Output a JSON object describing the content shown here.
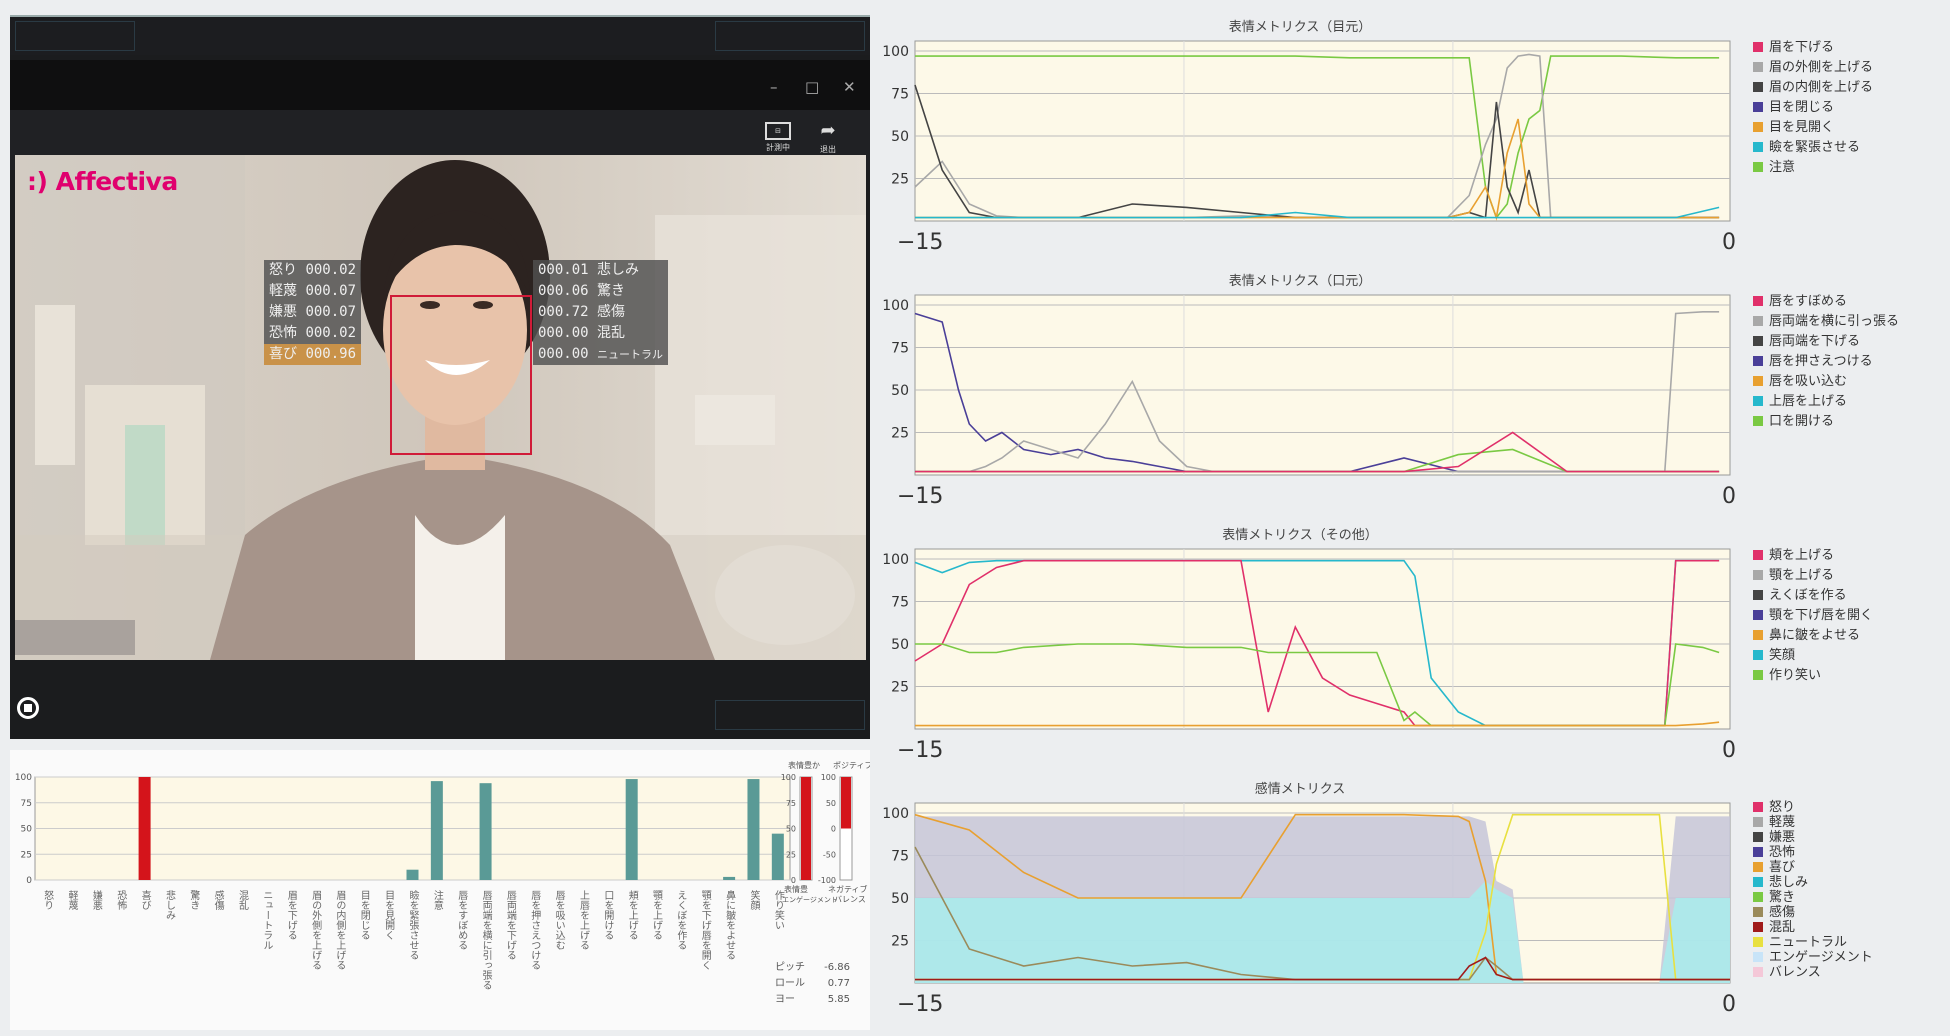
{
  "camera_app": {
    "logo": ":) Affectiva",
    "window_controls": {
      "minimize": "–",
      "maximize": "□",
      "close": "✕"
    },
    "toolbar": [
      {
        "label": "計測中",
        "icon": "record-icon"
      },
      {
        "label": "退出",
        "icon": "exit-icon"
      }
    ],
    "emotions_left": [
      {
        "label": "怒り",
        "value": "000.02"
      },
      {
        "label": "軽蔑",
        "value": "000.07"
      },
      {
        "label": "嫌悪",
        "value": "000.07"
      },
      {
        "label": "恐怖",
        "value": "000.02"
      },
      {
        "label": "喜び",
        "value": "000.96",
        "highlight": true
      }
    ],
    "emotions_right": [
      {
        "label": "悲しみ",
        "value": "000.01"
      },
      {
        "label": "驚き",
        "value": "000.06"
      },
      {
        "label": "感傷",
        "value": "000.72"
      },
      {
        "label": "混乱",
        "value": "000.00"
      },
      {
        "label": "ニュートラル",
        "value": "000.00"
      }
    ],
    "accent": "#e0006e",
    "face_box_color": "#d01b38"
  },
  "bar_panel": {
    "y_ticks": [
      "100",
      "75",
      "50",
      "25",
      "0"
    ],
    "bars": [
      {
        "label": "怒り",
        "value": 0,
        "color": "#5a9a96"
      },
      {
        "label": "軽蔑",
        "value": 0,
        "color": "#5a9a96"
      },
      {
        "label": "嫌悪",
        "value": 0,
        "color": "#5a9a96"
      },
      {
        "label": "恐怖",
        "value": 0,
        "color": "#5a9a96"
      },
      {
        "label": "喜び",
        "value": 100,
        "color": "#d4141b"
      },
      {
        "label": "悲しみ",
        "value": 0,
        "color": "#5a9a96"
      },
      {
        "label": "驚き",
        "value": 0,
        "color": "#5a9a96"
      },
      {
        "label": "感傷",
        "value": 0,
        "color": "#5a9a96"
      },
      {
        "label": "混乱",
        "value": 0,
        "color": "#5a9a96"
      },
      {
        "label": "ニュートラル",
        "value": 0,
        "color": "#5a9a96"
      },
      {
        "label": "眉を下げる",
        "value": 0,
        "color": "#5a9a96"
      },
      {
        "label": "眉の外側を上げる",
        "value": 0,
        "color": "#5a9a96"
      },
      {
        "label": "眉の内側を上げる",
        "value": 0,
        "color": "#5a9a96"
      },
      {
        "label": "目を閉じる",
        "value": 0,
        "color": "#5a9a96"
      },
      {
        "label": "目を見開く",
        "value": 0,
        "color": "#5a9a96"
      },
      {
        "label": "瞼を緊張させる",
        "value": 10,
        "color": "#5a9a96"
      },
      {
        "label": "注意",
        "value": 96,
        "color": "#5a9a96"
      },
      {
        "label": "唇をすぼめる",
        "value": 0,
        "color": "#5a9a96"
      },
      {
        "label": "唇両端を横に引っ張る",
        "value": 94,
        "color": "#5a9a96"
      },
      {
        "label": "唇両端を下げる",
        "value": 0,
        "color": "#5a9a96"
      },
      {
        "label": "唇を押さえつける",
        "value": 0,
        "color": "#5a9a96"
      },
      {
        "label": "唇を吸い込む",
        "value": 0,
        "color": "#5a9a96"
      },
      {
        "label": "上唇を上げる",
        "value": 0,
        "color": "#5a9a96"
      },
      {
        "label": "口を開ける",
        "value": 0,
        "color": "#5a9a96"
      },
      {
        "label": "頬を上げる",
        "value": 98,
        "color": "#5a9a96"
      },
      {
        "label": "顎を上げる",
        "value": 0,
        "color": "#5a9a96"
      },
      {
        "label": "えくぼを作る",
        "value": 0,
        "color": "#5a9a96"
      },
      {
        "label": "顎を下げ唇を開く",
        "value": 0,
        "color": "#5a9a96"
      },
      {
        "label": "鼻に皺をよせる",
        "value": 3,
        "color": "#5a9a96"
      },
      {
        "label": "笑顔",
        "value": 98,
        "color": "#5a9a96"
      },
      {
        "label": "作り笑い",
        "value": 45,
        "color": "#5a9a96"
      }
    ],
    "engagement": {
      "title": "表情豊か",
      "label": "エンゲージメント",
      "label_top": "表情豊",
      "ticks": [
        "100",
        "75",
        "50",
        "25",
        "0"
      ],
      "value": 100
    },
    "valence": {
      "title": "ポジティブ",
      "label": "ネガティブ",
      "label2": "バレンス",
      "ticks": [
        "100",
        "50",
        "0",
        "-50",
        "-100"
      ],
      "value": 100
    },
    "head_pose": [
      {
        "label": "ピッチ",
        "value": "-6.86"
      },
      {
        "label": "ロール",
        "value": "0.77"
      },
      {
        "label": "ヨー",
        "value": "5.85"
      }
    ]
  },
  "line_panels": [
    {
      "title": "表情メトリクス（目元）",
      "legend": [
        {
          "name": "眉を下げる",
          "color": "#e0306a"
        },
        {
          "name": "眉の外側を上げる",
          "color": "#a8a8a8"
        },
        {
          "name": "眉の内側を上げる",
          "color": "#444444"
        },
        {
          "name": "目を閉じる",
          "color": "#4a3f98"
        },
        {
          "name": "目を見開く",
          "color": "#e8a030"
        },
        {
          "name": "瞼を緊張させる",
          "color": "#26b8cc"
        },
        {
          "name": "注意",
          "color": "#7ac943"
        }
      ]
    },
    {
      "title": "表情メトリクス（口元）",
      "legend": [
        {
          "name": "唇をすぼめる",
          "color": "#e0306a"
        },
        {
          "name": "唇両端を横に引っ張る",
          "color": "#a8a8a8"
        },
        {
          "name": "唇両端を下げる",
          "color": "#444444"
        },
        {
          "name": "唇を押さえつける",
          "color": "#4a3f98"
        },
        {
          "name": "唇を吸い込む",
          "color": "#e8a030"
        },
        {
          "name": "上唇を上げる",
          "color": "#26b8cc"
        },
        {
          "name": "口を開ける",
          "color": "#7ac943"
        }
      ]
    },
    {
      "title": "表情メトリクス（その他）",
      "legend": [
        {
          "name": "頬を上げる",
          "color": "#e0306a"
        },
        {
          "name": "顎を上げる",
          "color": "#a8a8a8"
        },
        {
          "name": "えくぼを作る",
          "color": "#444444"
        },
        {
          "name": "顎を下げ唇を開く",
          "color": "#4a3f98"
        },
        {
          "name": "鼻に皺をよせる",
          "color": "#e8a030"
        },
        {
          "name": "笑顔",
          "color": "#26b8cc"
        },
        {
          "name": "作り笑い",
          "color": "#7ac943"
        }
      ]
    },
    {
      "title": "感情メトリクス",
      "legend": [
        {
          "name": "怒り",
          "color": "#e0306a"
        },
        {
          "name": "軽蔑",
          "color": "#a8a8a8"
        },
        {
          "name": "嫌悪",
          "color": "#444444"
        },
        {
          "name": "恐怖",
          "color": "#4a3f98"
        },
        {
          "name": "喜び",
          "color": "#e8a030"
        },
        {
          "name": "悲しみ",
          "color": "#26b8cc"
        },
        {
          "name": "驚き",
          "color": "#7ac943"
        },
        {
          "name": "感傷",
          "color": "#9a8a5a"
        },
        {
          "name": "混乱",
          "color": "#a01a1a"
        },
        {
          "name": "ニュートラル",
          "color": "#e8e040"
        },
        {
          "name": "エンゲージメント",
          "color": "#c8e4f8"
        },
        {
          "name": "バレンス",
          "color": "#f4c8d8"
        }
      ]
    }
  ],
  "line_axes": {
    "y_ticks": [
      "100",
      "75",
      "50",
      "25"
    ],
    "x_min": "−15",
    "x_max": "0",
    "plot_bg": "#fdf9e8"
  },
  "chart_data": [
    {
      "type": "line",
      "title": "表情メトリクス（目元）",
      "xlim": [
        -15,
        0
      ],
      "ylim": [
        0,
        100
      ],
      "x": [
        -15,
        -14.5,
        -14,
        -13.5,
        -13,
        -12,
        -11,
        -10,
        -9,
        -8,
        -7,
        -6,
        -5.2,
        -4.8,
        -4.5,
        -4.3,
        -4.1,
        -3.9,
        -3.7,
        -3.5,
        -3.3,
        -3.1,
        -2.9,
        -2,
        -1,
        -0.2
      ],
      "series": [
        {
          "name": "注意",
          "values": [
            97,
            97,
            97,
            97,
            97,
            97,
            97,
            97,
            97,
            97,
            96,
            96,
            96,
            96,
            20,
            2,
            10,
            40,
            60,
            65,
            97,
            97,
            97,
            97,
            96,
            96
          ]
        },
        {
          "name": "眉の外側を上げる",
          "values": [
            20,
            35,
            10,
            3,
            2,
            2,
            2,
            2,
            3,
            2,
            2,
            2,
            2,
            15,
            45,
            60,
            90,
            97,
            98,
            97,
            2,
            2,
            2,
            2,
            2,
            2
          ]
        },
        {
          "name": "眉の内側を上げる",
          "values": [
            80,
            30,
            5,
            2,
            2,
            2,
            10,
            8,
            5,
            2,
            2,
            2,
            2,
            5,
            2,
            70,
            20,
            5,
            30,
            2,
            2,
            2,
            2,
            2,
            2,
            2
          ]
        },
        {
          "name": "目を見開く",
          "values": [
            2,
            2,
            2,
            2,
            2,
            2,
            2,
            2,
            2,
            2,
            2,
            2,
            2,
            5,
            20,
            2,
            40,
            60,
            10,
            2,
            2,
            2,
            2,
            2,
            2,
            2
          ]
        },
        {
          "name": "瞼を緊張させる",
          "values": [
            2,
            2,
            2,
            2,
            2,
            2,
            2,
            2,
            2,
            5,
            2,
            2,
            2,
            2,
            2,
            2,
            2,
            2,
            2,
            2,
            2,
            2,
            2,
            2,
            2,
            8
          ]
        }
      ]
    },
    {
      "type": "line",
      "title": "表情メトリクス（口元）",
      "xlim": [
        -15,
        0
      ],
      "ylim": [
        0,
        100
      ],
      "x": [
        -15,
        -14.5,
        -14.2,
        -14,
        -13.7,
        -13.4,
        -13,
        -12.5,
        -12,
        -11.5,
        -11,
        -10.5,
        -10,
        -9.5,
        -9,
        -8,
        -7,
        -6,
        -5,
        -4,
        -3,
        -2,
        -1.2,
        -1,
        -0.5,
        -0.2
      ],
      "series": [
        {
          "name": "唇を押さえつける",
          "values": [
            95,
            90,
            50,
            30,
            20,
            25,
            15,
            12,
            15,
            10,
            8,
            5,
            2,
            2,
            2,
            2,
            2,
            10,
            2,
            2,
            2,
            2,
            2,
            2,
            2,
            2
          ]
        },
        {
          "name": "唇両端を横に引っ張る",
          "values": [
            2,
            2,
            2,
            2,
            5,
            10,
            20,
            15,
            10,
            30,
            55,
            20,
            5,
            2,
            2,
            2,
            2,
            2,
            2,
            2,
            2,
            2,
            2,
            95,
            96,
            96
          ]
        },
        {
          "name": "口を開ける",
          "values": [
            2,
            2,
            2,
            2,
            2,
            2,
            2,
            2,
            2,
            2,
            2,
            2,
            2,
            2,
            2,
            2,
            2,
            2,
            12,
            15,
            2,
            2,
            2,
            2,
            2,
            2
          ]
        },
        {
          "name": "唇をすぼめる",
          "values": [
            2,
            2,
            2,
            2,
            2,
            2,
            2,
            2,
            2,
            2,
            2,
            2,
            2,
            2,
            2,
            2,
            2,
            2,
            5,
            25,
            2,
            2,
            2,
            2,
            2,
            2
          ]
        }
      ]
    },
    {
      "type": "line",
      "title": "表情メトリクス（その他）",
      "xlim": [
        -15,
        0
      ],
      "ylim": [
        0,
        100
      ],
      "x": [
        -15,
        -14.5,
        -14,
        -13.5,
        -13,
        -12,
        -11,
        -10,
        -9,
        -8.5,
        -8,
        -7.5,
        -7,
        -6.5,
        -6,
        -5.8,
        -5.5,
        -5,
        -4.5,
        -4,
        -3,
        -2,
        -1.2,
        -1,
        -0.5,
        -0.2
      ],
      "series": [
        {
          "name": "笑顔",
          "values": [
            98,
            92,
            98,
            99,
            99,
            99,
            99,
            99,
            99,
            99,
            99,
            99,
            99,
            99,
            99,
            90,
            30,
            10,
            2,
            2,
            2,
            2,
            2,
            99,
            99,
            99
          ]
        },
        {
          "name": "頬を上げる",
          "values": [
            40,
            50,
            85,
            95,
            99,
            99,
            99,
            99,
            99,
            10,
            60,
            30,
            20,
            15,
            10,
            2,
            2,
            2,
            2,
            2,
            2,
            2,
            2,
            99,
            99,
            99
          ]
        },
        {
          "name": "作り笑い",
          "values": [
            50,
            50,
            45,
            45,
            48,
            50,
            50,
            48,
            48,
            45,
            45,
            45,
            45,
            45,
            5,
            10,
            2,
            2,
            2,
            2,
            2,
            2,
            2,
            50,
            48,
            45
          ]
        },
        {
          "name": "鼻に皺をよせる",
          "values": [
            2,
            2,
            2,
            2,
            2,
            2,
            2,
            2,
            2,
            2,
            2,
            2,
            2,
            2,
            2,
            2,
            2,
            2,
            2,
            2,
            2,
            2,
            2,
            2,
            3,
            4
          ]
        }
      ]
    },
    {
      "type": "area",
      "title": "感情メトリクス",
      "xlim": [
        -15,
        0
      ],
      "ylim": [
        0,
        100
      ],
      "x": [
        -15,
        -14,
        -13,
        -12,
        -11,
        -10,
        -9,
        -8,
        -7,
        -6,
        -5,
        -4.8,
        -4.5,
        -4.3,
        -4,
        -3.8,
        -3.5,
        -3,
        -2,
        -1.3,
        -1,
        -0.5,
        0
      ],
      "series": [
        {
          "name": "エンゲージメント",
          "values": [
            98,
            98,
            98,
            98,
            98,
            98,
            98,
            98,
            98,
            98,
            98,
            98,
            95,
            60,
            55,
            0,
            0,
            0,
            0,
            0,
            98,
            98,
            98
          ]
        },
        {
          "name": "バレンス",
          "values": [
            50,
            50,
            50,
            50,
            50,
            50,
            50,
            50,
            50,
            50,
            50,
            50,
            60,
            55,
            50,
            0,
            0,
            0,
            0,
            0,
            50,
            50,
            50
          ]
        },
        {
          "name": "喜び",
          "values": [
            99,
            90,
            65,
            50,
            50,
            50,
            50,
            99,
            99,
            99,
            98,
            95,
            60,
            5,
            2,
            2,
            2,
            2,
            2,
            2,
            2,
            2,
            2
          ]
        },
        {
          "name": "ニュートラル",
          "values": [
            2,
            2,
            2,
            2,
            2,
            2,
            2,
            2,
            2,
            2,
            2,
            2,
            30,
            70,
            99,
            99,
            99,
            99,
            99,
            99,
            2,
            2,
            2
          ]
        },
        {
          "name": "感傷",
          "values": [
            80,
            20,
            10,
            15,
            10,
            12,
            5,
            2,
            2,
            2,
            2,
            2,
            15,
            10,
            2,
            2,
            2,
            2,
            2,
            2,
            2,
            2,
            2
          ]
        },
        {
          "name": "混乱",
          "values": [
            2,
            2,
            2,
            2,
            2,
            2,
            2,
            2,
            2,
            2,
            2,
            10,
            15,
            5,
            2,
            2,
            2,
            2,
            2,
            2,
            2,
            2,
            2
          ]
        }
      ]
    }
  ]
}
